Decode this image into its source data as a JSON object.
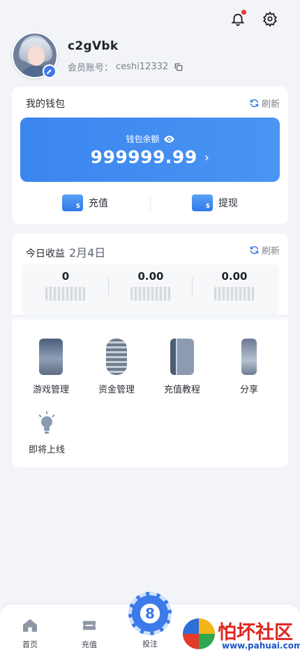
{
  "colors": {
    "accent": "#3a86ef",
    "badge_red": "#e33333",
    "page_bg": "#f2f4f8"
  },
  "header": {
    "bell_icon": "bell-icon",
    "settings_icon": "gear-icon",
    "has_notification": true
  },
  "profile": {
    "username": "c2gVbk",
    "account_label": "会员账号：",
    "account_value": "ceshi12332"
  },
  "wallet": {
    "title": "我的钱包",
    "refresh_label": "刷新",
    "balance_label": "钱包余额",
    "balance_value": "999999.99",
    "arrow": "›",
    "recharge_label": "充值",
    "withdraw_label": "提现"
  },
  "earnings": {
    "title": "今日收益",
    "date": "2月4日",
    "refresh_label": "刷新",
    "stats": [
      {
        "value": "0"
      },
      {
        "value": "0.00"
      },
      {
        "value": "0.00"
      }
    ]
  },
  "menu": {
    "items": [
      {
        "label": "游戏管理",
        "icon": "game-manage-icon"
      },
      {
        "label": "资金管理",
        "icon": "fund-manage-icon"
      },
      {
        "label": "充值教程",
        "icon": "tutorial-icon"
      },
      {
        "label": "分享",
        "icon": "share-icon"
      },
      {
        "label": "即将上线",
        "icon": "lightbulb-icon"
      }
    ]
  },
  "bottom_nav": {
    "home": "首页",
    "recharge": "充值",
    "bet": "投注",
    "bet_glyph": "8"
  },
  "watermark": {
    "title": "怕坏社区",
    "url": "www.pahuai.com"
  }
}
